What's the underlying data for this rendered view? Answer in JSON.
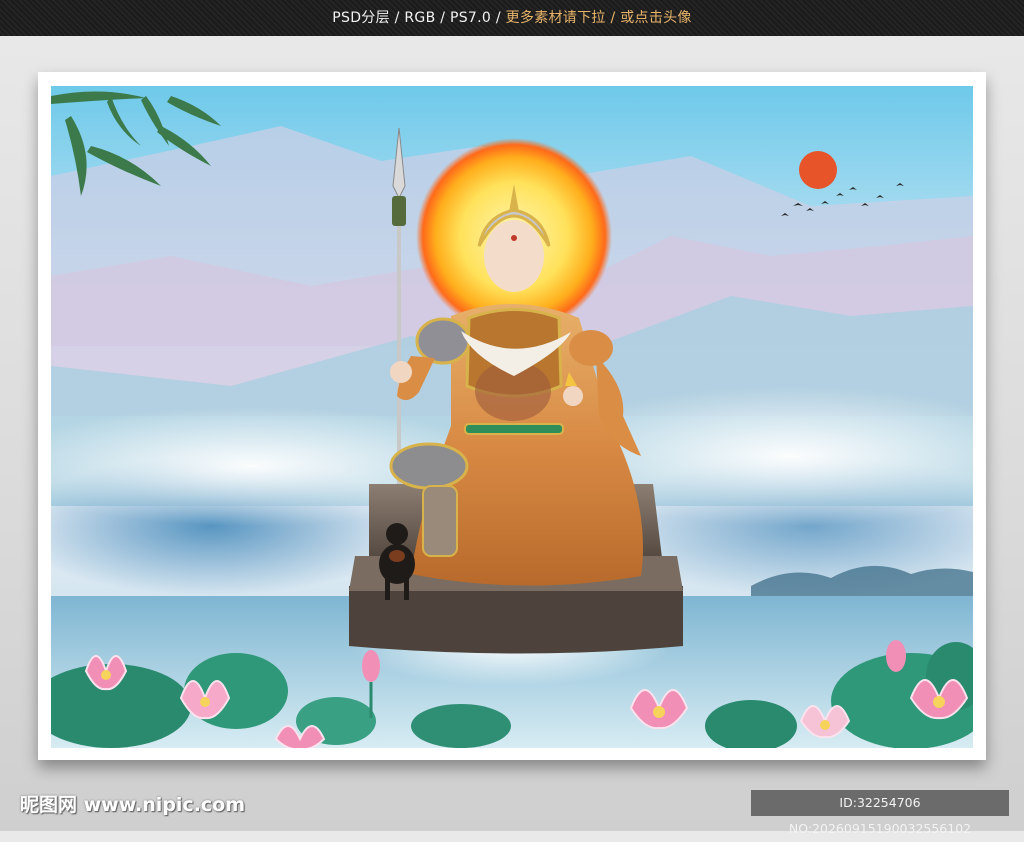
{
  "header": {
    "meta_text": "PSD分层 / RGB / PS7.0 / ",
    "promo_text": "更多素材请下拉 / 或点击头像"
  },
  "watermark": {
    "site_text": "昵图网 www.nipic.com",
    "id_text": "ID:32254706 NO:20260915190032556102"
  },
  "colors": {
    "sky_top": "#6ec9ea",
    "sun": "#e8542a",
    "halo": "#ffb21e",
    "robe": "#d98d45",
    "lotus": "#f28fb6",
    "leaf": "#2a8a6e"
  }
}
